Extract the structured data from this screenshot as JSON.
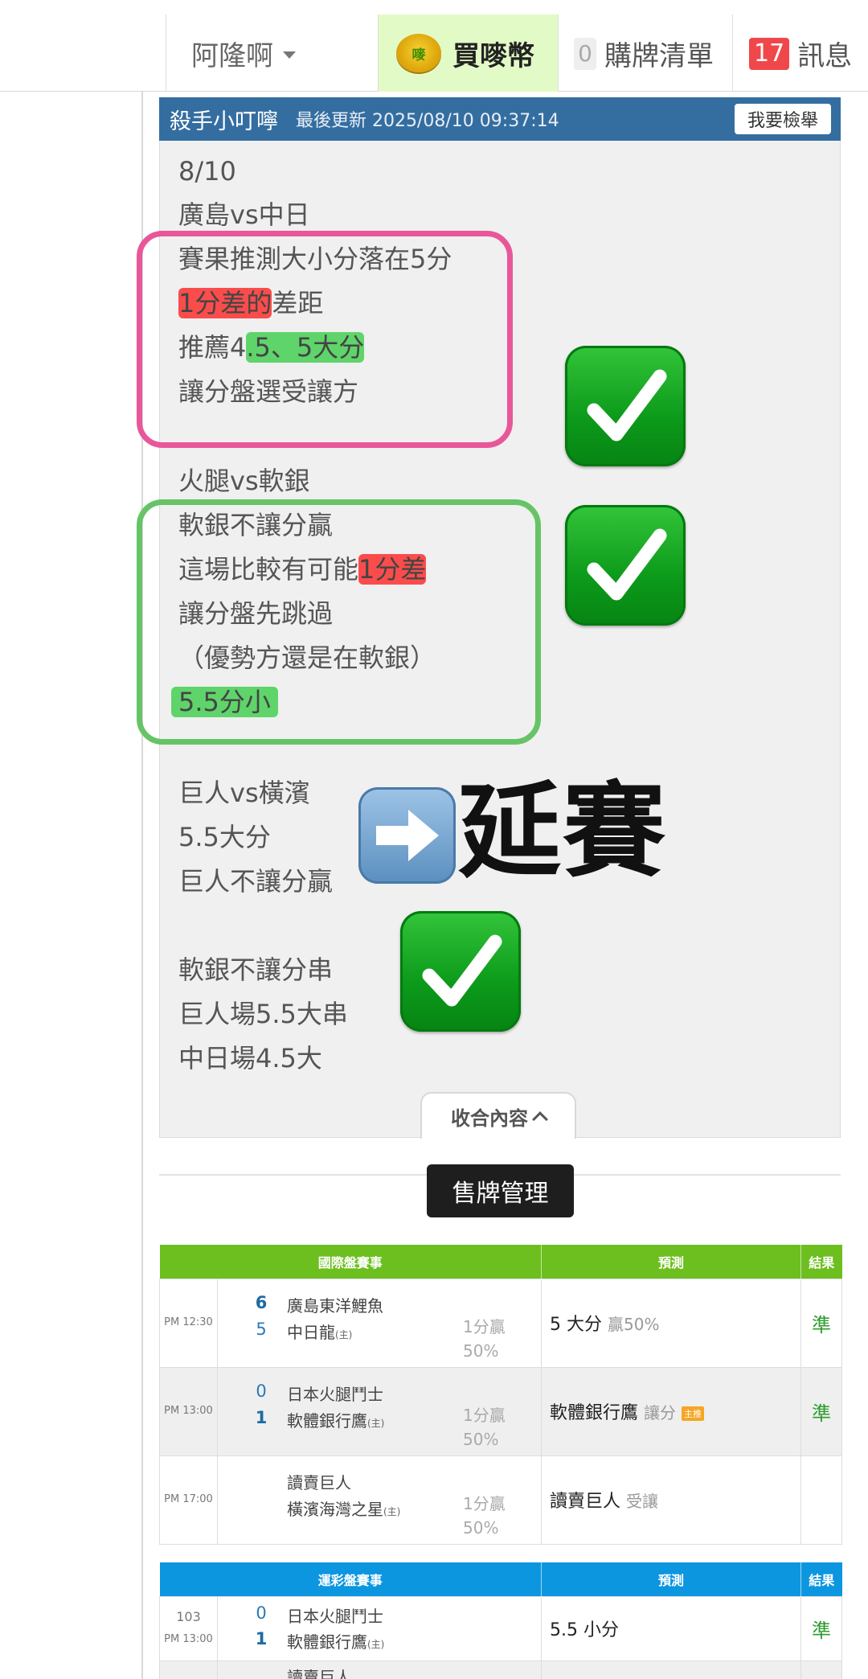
{
  "nav": {
    "user_name": "阿隆啊",
    "buy_label": "買嘜幣",
    "coin_glyph": "嘜",
    "cart_count": "0",
    "cart_label": "購牌清單",
    "msg_count": "17",
    "msg_label": "訊息"
  },
  "post": {
    "author": "殺手小叮嚀",
    "updated": "最後更新 2025/08/10 09:37:14",
    "report_label": "我要檢舉",
    "lines": {
      "l1": "8/10",
      "l2": "廣島vs中日",
      "l3": "賽果推測大小分落在5分",
      "l4_hl": "1分差的",
      "l4_rest": "差距",
      "l5_pre": "推薦4",
      "l5_hl": ".5、5大分",
      "l6": "讓分盤選受讓方",
      "l7": "火腿vs軟銀",
      "l8": "軟銀不讓分贏",
      "l9_pre": "這場比較有可能",
      "l9_hl": "1分差",
      "l10": "讓分盤先跳過",
      "l11": "（優勢方還是在軟銀）",
      "l12_hl": "5.5分小",
      "l13": "巨人vs橫濱",
      "l14": "5.5大分",
      "l15": "巨人不讓分贏",
      "l16": "軟銀不讓分串",
      "l17": "巨人場5.5大串",
      "l18": "中日場4.5大"
    },
    "delay_text": "延賽",
    "collapse_label": "收合內容"
  },
  "sales_button": "售牌管理",
  "table_intl": {
    "headers": {
      "event": "國際盤賽事",
      "prediction": "預測",
      "result": "結果"
    },
    "rows": [
      {
        "time": "PM 12:30",
        "s1": "6",
        "s2": "5",
        "t1": "廣島東洋鯉魚",
        "t2": "中日龍",
        "home": "(主)",
        "hcap1": "1分贏",
        "hcap2": "50%",
        "pred": "5 大分",
        "pred_sub": "贏50%",
        "tag": "",
        "result": "準"
      },
      {
        "time": "PM 13:00",
        "s1": "0",
        "s2": "1",
        "t1": "日本火腿鬥士",
        "t2": "軟體銀行鷹",
        "home": "(主)",
        "hcap1": "1分贏",
        "hcap2": "50%",
        "pred": "軟體銀行鷹",
        "pred_sub": "讓分",
        "tag": "主推",
        "result": "準"
      },
      {
        "time": "PM 17:00",
        "s1": "",
        "s2": "",
        "t1": "讀賣巨人",
        "t2": "橫濱海灣之星",
        "home": "(主)",
        "hcap1": "1分贏",
        "hcap2": "50%",
        "pred": "讀賣巨人",
        "pred_sub": "受讓",
        "tag": "",
        "result": ""
      }
    ]
  },
  "table_lottery": {
    "headers": {
      "event": "運彩盤賽事",
      "prediction": "預測",
      "result": "結果"
    },
    "rows": [
      {
        "num": "103",
        "time": "PM 13:00",
        "s1": "0",
        "s2": "1",
        "t1": "日本火腿鬥士",
        "t2": "軟體銀行鷹",
        "home": "(主)",
        "pred": "5.5 小分",
        "result": "準"
      },
      {
        "t1": "讀賣巨人"
      }
    ]
  },
  "colors": {
    "header_blue": "#346ea1",
    "intl_green": "#6cbf1f",
    "lottery_blue": "#0d96e0",
    "result_green": "#2d9c2d",
    "pink_box": "#e8579a",
    "green_box": "#66c466"
  },
  "icons": [
    "chevron-down-icon",
    "coin-icon",
    "check-mark-icon",
    "right-arrow-icon",
    "chevron-up-icon"
  ]
}
